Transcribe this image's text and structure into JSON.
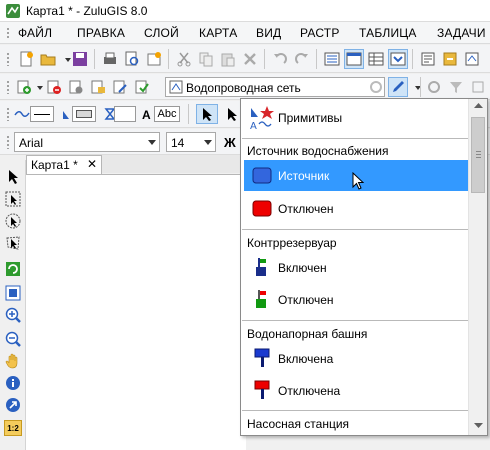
{
  "window": {
    "title": "Карта1 * - ZuluGIS 8.0"
  },
  "menu": [
    "ФАЙЛ",
    "ПРАВКА",
    "СЛОЙ",
    "КАРТА",
    "ВИД",
    "РАСТР",
    "ТАБЛИЦА",
    "ЗАДАЧИ"
  ],
  "layer_combo": {
    "value": "Водопроводная сеть"
  },
  "font": {
    "family": "Arial",
    "size": "14",
    "bold_label": "Ж"
  },
  "style_text_button": "Abc",
  "style_text_a": "A",
  "map_tab": {
    "label": "Карта1 *",
    "close": "✕"
  },
  "left_toolbar_badge": "1:2",
  "popup": {
    "primitives_label": "Примитивы",
    "sections": [
      {
        "header": "Источник водоснабжения",
        "items": [
          {
            "label": "Источник",
            "icon": "source-on-icon",
            "selected": true
          },
          {
            "label": "Отключен",
            "icon": "source-off-icon",
            "selected": false
          }
        ]
      },
      {
        "header": "Контррезервуар",
        "items": [
          {
            "label": "Включен",
            "icon": "reservoir-on-icon"
          },
          {
            "label": "Отключен",
            "icon": "reservoir-off-icon"
          }
        ]
      },
      {
        "header": "Водонапорная башня",
        "items": [
          {
            "label": "Включена",
            "icon": "tower-on-icon"
          },
          {
            "label": "Отключена",
            "icon": "tower-off-icon"
          }
        ]
      },
      {
        "header": "Насосная станция",
        "items": []
      }
    ]
  },
  "colors": {
    "selection": "#3399ff",
    "source_on": "#3366dd",
    "off_red": "#ee0000",
    "on_green": "#119911"
  }
}
